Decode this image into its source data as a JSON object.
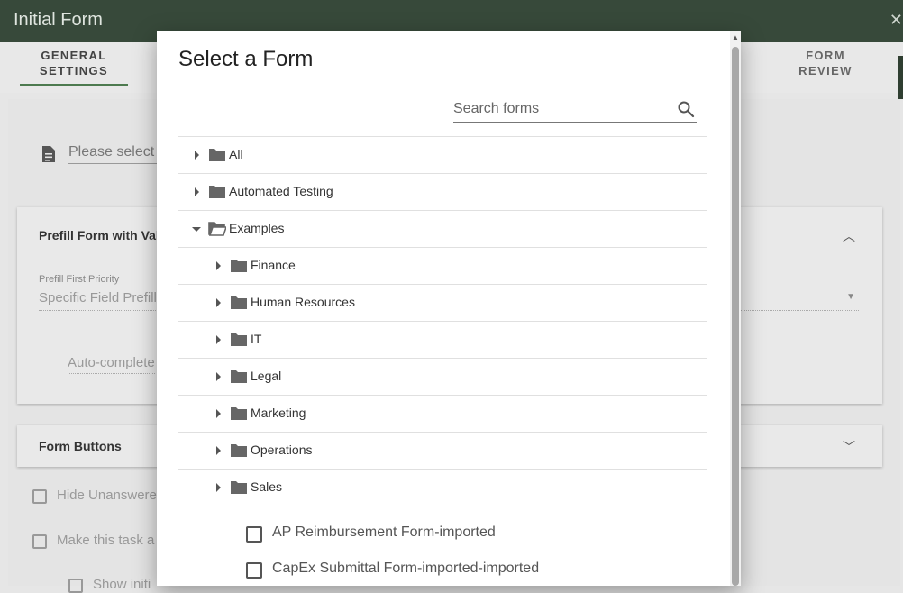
{
  "app": {
    "title": "Initial Form"
  },
  "tabs": {
    "general": "GENERAL\nSETTINGS",
    "review": "FORM\nREVIEW"
  },
  "background": {
    "please_select": "Please select a form",
    "panel_prefill_title": "Prefill Form with Values",
    "prefill_label": "Prefill First Priority",
    "prefill_value": "Specific Field Prefill",
    "autocomplete": "Auto-complete",
    "panel_buttons_title": "Form Buttons",
    "check1": "Hide Unanswered",
    "check2": "Make this task a",
    "check3": "Show initi"
  },
  "modal": {
    "title": "Select a Form",
    "search_placeholder": "Search forms",
    "tree": [
      {
        "label": "All",
        "level": 0,
        "expanded": false
      },
      {
        "label": "Automated Testing",
        "level": 0,
        "expanded": false
      },
      {
        "label": "Examples",
        "level": 0,
        "expanded": true
      },
      {
        "label": "Finance",
        "level": 1,
        "expanded": false
      },
      {
        "label": "Human Resources",
        "level": 1,
        "expanded": false
      },
      {
        "label": "IT",
        "level": 1,
        "expanded": false
      },
      {
        "label": "Legal",
        "level": 1,
        "expanded": false
      },
      {
        "label": "Marketing",
        "level": 1,
        "expanded": false
      },
      {
        "label": "Operations",
        "level": 1,
        "expanded": false
      },
      {
        "label": "Sales",
        "level": 1,
        "expanded": false
      }
    ],
    "forms": [
      {
        "label": "AP Reimbursement Form-imported",
        "checked": false
      },
      {
        "label": "CapEx Submittal Form-imported-imported",
        "checked": false
      }
    ]
  },
  "colors": {
    "topbar": "#37493a",
    "accent": "#4d7a4f",
    "folder": "#666666"
  },
  "icons": {
    "folder": "folder-icon",
    "folder_open": "folder-open-icon",
    "caret_right": "caret-right-icon",
    "caret_down": "caret-down-icon",
    "search": "search-icon",
    "document": "document-icon"
  }
}
